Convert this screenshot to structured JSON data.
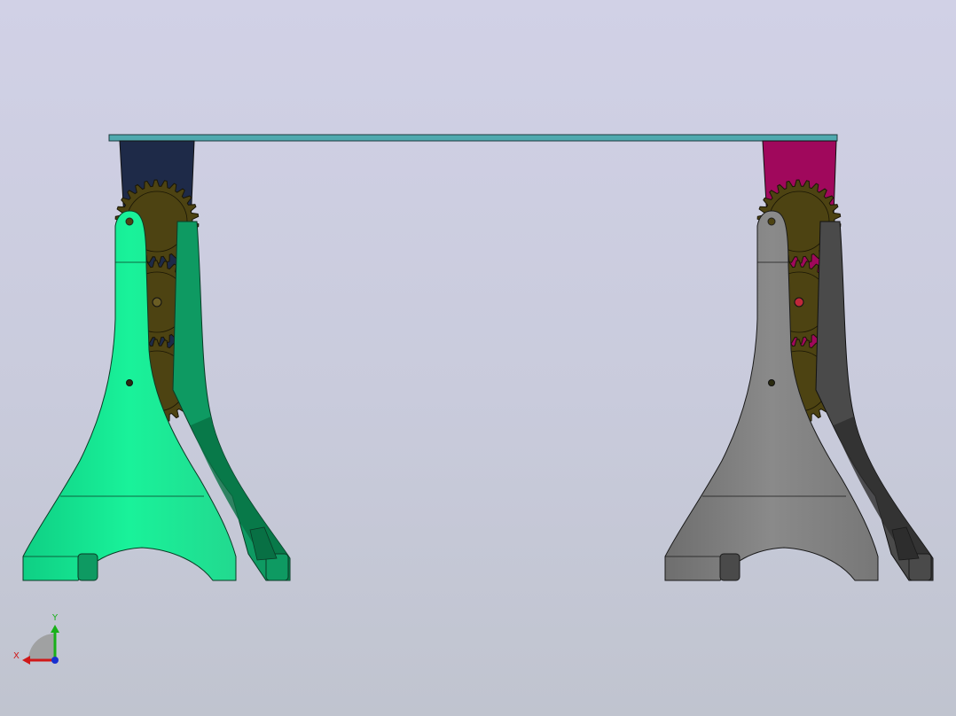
{
  "viewport": {
    "background_top": "#d1d1e6",
    "background_bottom": "#c0c4cf"
  },
  "model": {
    "rail_color": "#4fa9ae",
    "left_support": {
      "body_color": "#19f29a",
      "shade_color": "#0e9a62",
      "dark_color": "#087044",
      "arm_color": "#1e2a48"
    },
    "right_support": {
      "body_color": "#838383",
      "shade_color": "#4a4a4a",
      "dark_color": "#2d2d2d",
      "arm_color": "#a0085c"
    },
    "gear_color": "#4d4312",
    "gear_center_color": "#3a3210",
    "gears_per_side": 3,
    "highlight_pin_color": "#c0283a"
  },
  "triad": {
    "x_label": "X",
    "y_label": "Y",
    "x_color": "#d01818",
    "y_color": "#18b018",
    "z_color": "#1830d0"
  }
}
